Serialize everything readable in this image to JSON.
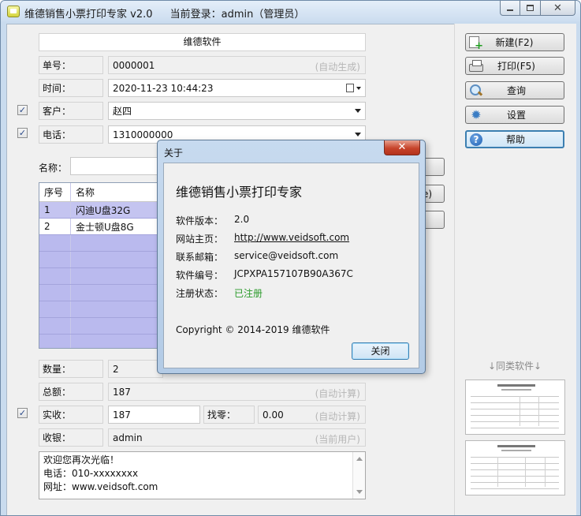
{
  "window": {
    "title": "维德销售小票打印专家 v2.0",
    "login_label": "当前登录：admin（管理员）"
  },
  "receipt": {
    "shop_name": "维德软件",
    "labels": {
      "number": "单号：",
      "time": "时间：",
      "customer": "客户：",
      "phone": "电话：",
      "name": "名称：",
      "quantity": "数量：",
      "total": "总额：",
      "received": "实收：",
      "change": "找零：",
      "cashier": "收银："
    },
    "values": {
      "number": "0000001",
      "time": "2020-11-23 10:44:23",
      "customer": "赵四",
      "phone": "1310000000",
      "quantity": "2",
      "total": "187",
      "received": "187",
      "change": "0.00",
      "cashier": "admin"
    },
    "hints": {
      "number": "(自动生成)",
      "total": "(自动计算)",
      "change": "(自动计算)",
      "cashier": "(当前用户)"
    },
    "checks": {
      "customer": "✓",
      "phone": "✓",
      "received": "✓"
    },
    "hidden_buttons": [
      ")",
      "e)"
    ],
    "note_lines": [
      "欢迎您再次光临！",
      "电话：010-xxxxxxxx",
      "网址：www.veidsoft.com"
    ]
  },
  "items_table": {
    "headers": [
      "序号",
      "名称"
    ],
    "rows": [
      {
        "no": "1",
        "name": "闪迪U盘32G"
      },
      {
        "no": "2",
        "name": "金士顿U盘8G"
      }
    ]
  },
  "toolbar": {
    "new": "新建(F2)",
    "print": "打印(F5)",
    "query": "查询",
    "settings": "设置",
    "help": "帮助"
  },
  "similar_software": "↓同类软件↓",
  "icons": [
    "new-icon",
    "print-icon",
    "search-icon",
    "gear-icon",
    "help-icon",
    "close-icon",
    "minimize-icon",
    "maximize-icon",
    "calendar-icon",
    "chevron-down-icon"
  ],
  "about": {
    "title": "关于",
    "close_glyph": "✕",
    "app_name": "维德销售小票打印专家",
    "rows": [
      {
        "key": "软件版本：",
        "value": "2.0"
      },
      {
        "key": "网站主页：",
        "value": "http://www.veidsoft.com"
      },
      {
        "key": "联系邮箱：",
        "value": "service@veidsoft.com"
      },
      {
        "key": "软件编号：",
        "value": "JCPXPA157107B90A367C"
      },
      {
        "key": "注册状态：",
        "value": "已注册"
      }
    ],
    "copyright": "Copyright © 2014-2019 维德软件",
    "close_button": "关闭"
  },
  "colors": {
    "titlebar": "#cbdcef",
    "table_row": "#b9b9ee",
    "registered": "#2a9a2a",
    "close_red": "#c7442b"
  }
}
